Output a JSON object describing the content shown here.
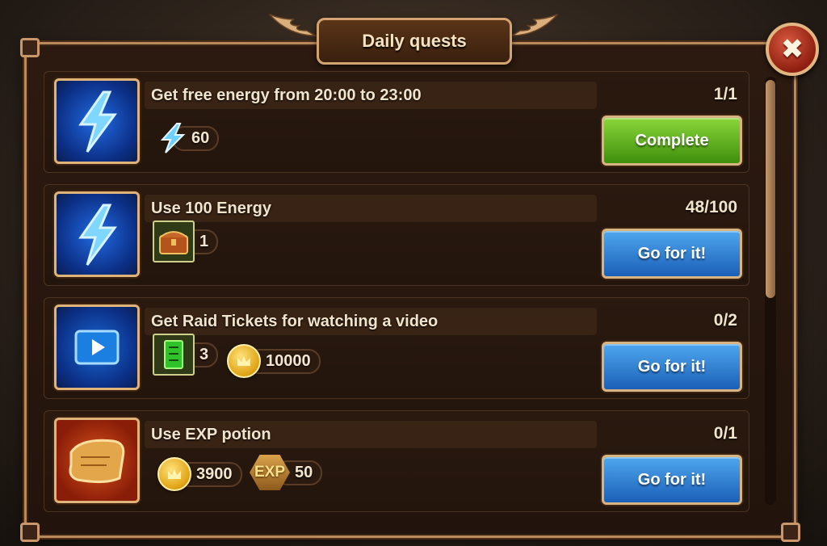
{
  "header": {
    "title": "Daily quests",
    "close_label": "✖"
  },
  "colors": {
    "complete": "#5aaf1f",
    "go": "#2f7fd4",
    "frame": "#b9895a"
  },
  "quests": [
    {
      "icon": "energy-icon",
      "title": "Get free energy from 20:00 to 23:00",
      "progress": "1/1",
      "button": "Complete",
      "rewards": [
        {
          "icon": "energy-icon",
          "amount": "60"
        }
      ]
    },
    {
      "icon": "energy-icon",
      "title": "Use 100 Energy",
      "progress": "48/100",
      "button": "Go for it!",
      "rewards": [
        {
          "icon": "chest-icon",
          "amount": "1"
        }
      ]
    },
    {
      "icon": "video-icon",
      "title": "Get Raid Tickets for watching a video",
      "progress": "0/2",
      "button": "Go for it!",
      "rewards": [
        {
          "icon": "raid-ticket-icon",
          "amount": "3"
        },
        {
          "icon": "gold-coin-icon",
          "amount": "10000"
        }
      ]
    },
    {
      "icon": "scroll-icon",
      "title": "Use EXP potion",
      "progress": "0/1",
      "button": "Go for it!",
      "rewards": [
        {
          "icon": "gold-coin-icon",
          "amount": "3900"
        },
        {
          "icon": "exp-icon",
          "amount": "50",
          "label": "EXP"
        }
      ]
    }
  ]
}
